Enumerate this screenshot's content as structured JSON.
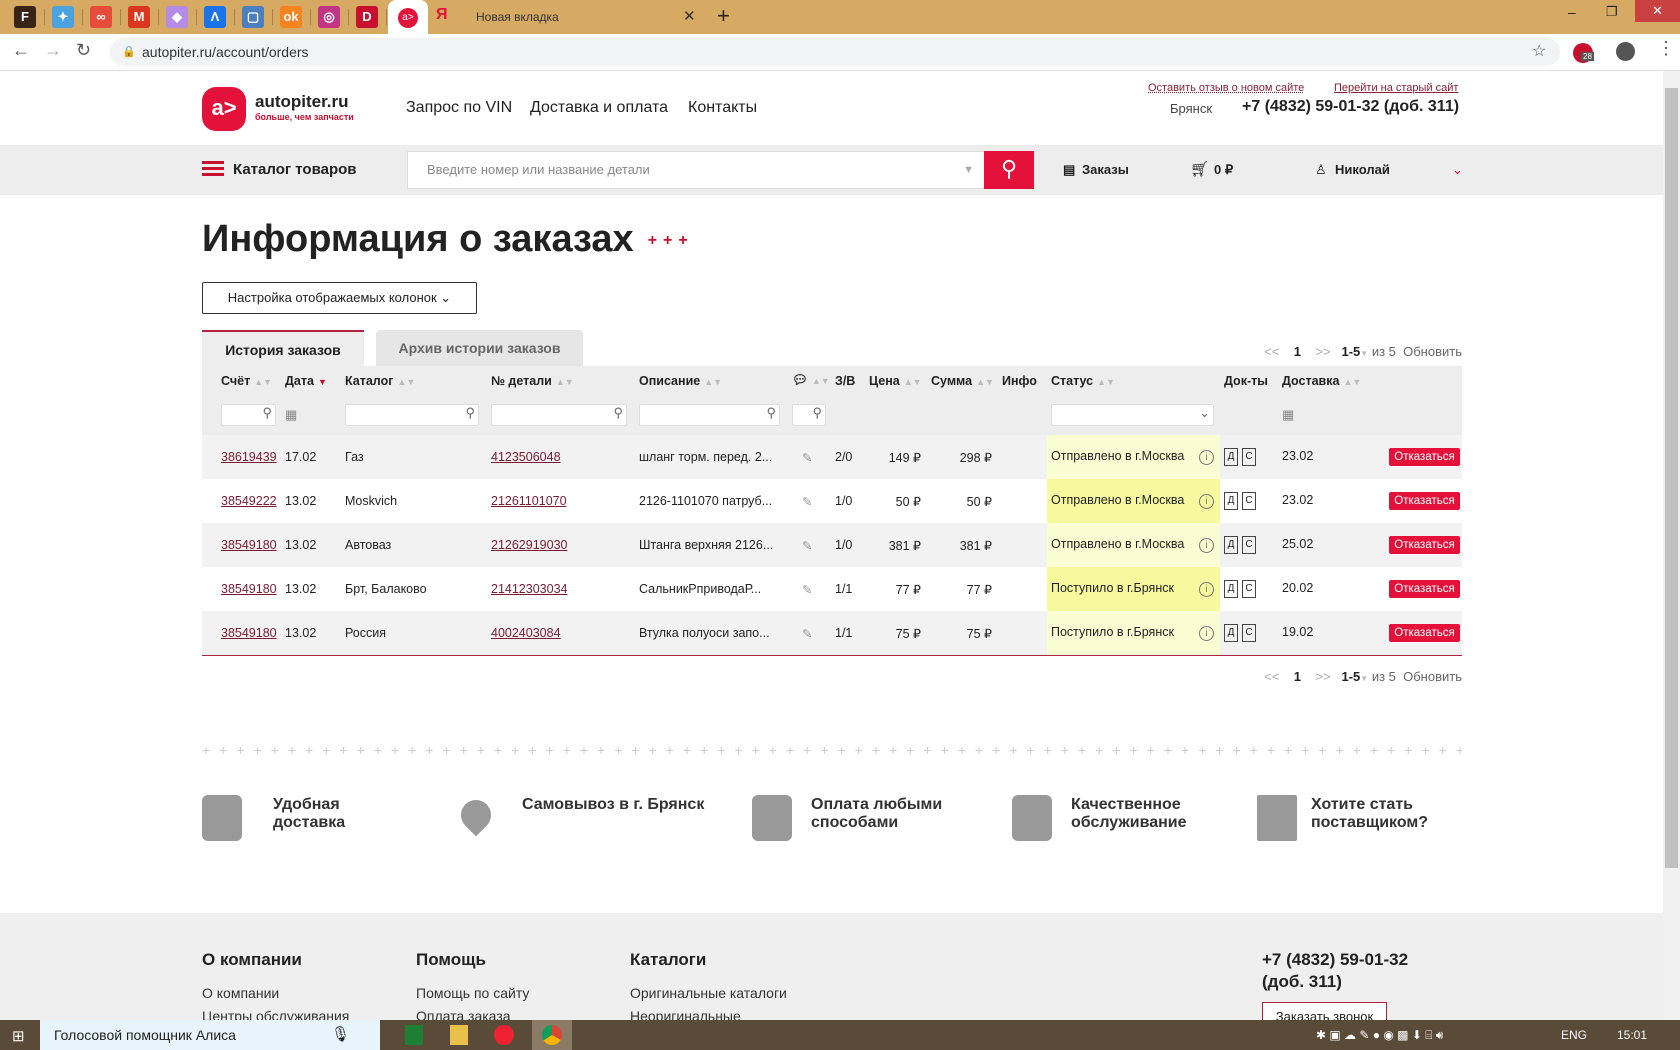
{
  "browser": {
    "new_tab_title": "Новая вкладка",
    "url": "autopiter.ru/account/orders",
    "ext_badge": "28",
    "fav_tabs": [
      {
        "g": "F",
        "c": "#3a2418"
      },
      {
        "g": "✦",
        "c": "#4aa3df"
      },
      {
        "g": "∞",
        "c": "#e64b3c"
      },
      {
        "g": "M",
        "c": "#d9381e"
      },
      {
        "g": "◆",
        "c": "#b58be8"
      },
      {
        "g": "Λ",
        "c": "#1a73e8"
      },
      {
        "g": "▢",
        "c": "#4a7fc1"
      },
      {
        "g": "ok",
        "c": "#f48420"
      },
      {
        "g": "◎",
        "c": "#c13584"
      },
      {
        "g": "D",
        "c": "#c8102e"
      }
    ]
  },
  "header": {
    "logo_text": "autopiter.ru",
    "logo_slogan": "больше, чем запчасти",
    "nav": [
      "Запрос по VIN",
      "Доставка и оплата",
      "Контакты"
    ],
    "feedback_link": "Оставить отзыв о новом сайте",
    "old_site_link": "Перейти на старый сайт",
    "city": "Брянск",
    "phone": "+7 (4832) 59-01-32 (доб. 311)"
  },
  "navbar": {
    "catalog": "Каталог товаров",
    "search_placeholder": "Введите номер или название детали",
    "orders": "Заказы",
    "cart": "0 ₽",
    "user": "Николай"
  },
  "page": {
    "title": "Информация о заказах",
    "columns_button": "Настройка отображаемых колонок",
    "tabs": [
      "История заказов",
      "Архив истории заказов"
    ],
    "pager": {
      "prev": "<<",
      "page": "1",
      "next": ">>",
      "range": "1-5",
      "of": "из 5",
      "refresh": "Обновить"
    }
  },
  "table": {
    "headers": [
      "Счёт",
      "Дата",
      "Каталог",
      "№ детали",
      "Описание",
      "",
      "З/В",
      "Цена",
      "Сумма",
      "Инфо",
      "Статус",
      "Док-ты",
      "Доставка"
    ],
    "refuse_label": "Отказаться",
    "doc_labels": [
      "Д",
      "С"
    ],
    "rows": [
      {
        "invoice": "38619439",
        "date": "17.02",
        "catalog": "Газ",
        "part": "4123506048",
        "desc": "шланг торм. перед. 2...",
        "zv": "2/0",
        "price": "149 ₽",
        "sum": "298 ₽",
        "status": "Отправлено в г.Москва",
        "delivery": "23.02"
      },
      {
        "invoice": "38549222",
        "date": "13.02",
        "catalog": "Moskvich",
        "part": "21261101070",
        "desc": "2126-1101070 патруб...",
        "zv": "1/0",
        "price": "50 ₽",
        "sum": "50 ₽",
        "status": "Отправлено в г.Москва",
        "delivery": "23.02"
      },
      {
        "invoice": "38549180",
        "date": "13.02",
        "catalog": "Автоваз",
        "part": "21262919030",
        "desc": "Штанга верхняя 2126...",
        "zv": "1/0",
        "price": "381 ₽",
        "sum": "381 ₽",
        "status": "Отправлено в г.Москва",
        "delivery": "25.02"
      },
      {
        "invoice": "38549180",
        "date": "13.02",
        "catalog": "Брт, Балаково",
        "part": "21412303034",
        "desc": "СальникРприводаР...",
        "zv": "1/1",
        "price": "77 ₽",
        "sum": "77 ₽",
        "status": "Поступило в г.Брянск",
        "delivery": "20.02"
      },
      {
        "invoice": "38549180",
        "date": "13.02",
        "catalog": "Россия",
        "part": "4002403084",
        "desc": "Втулка полуоси запо...",
        "zv": "1/1",
        "price": "75 ₽",
        "sum": "75 ₽",
        "status": "Поступило в г.Брянск",
        "delivery": "19.02"
      }
    ]
  },
  "features": [
    "Удобная доставка",
    "Самовывоз в г. Брянск",
    "Оплата любыми способами",
    "Качественное обслуживание",
    "Хотите стать поставщиком?"
  ],
  "footer": {
    "cols": [
      {
        "title": "О компании",
        "links": [
          "О компании",
          "Центры обслуживания"
        ]
      },
      {
        "title": "Помощь",
        "links": [
          "Помощь по сайту",
          "Оплата заказа"
        ]
      },
      {
        "title": "Каталоги",
        "links": [
          "Оригинальные каталоги",
          "Неоригинальные"
        ]
      }
    ],
    "phone": "+7 (4832) 59-01-32",
    "phone_ext": "(доб. 311)",
    "call_button": "Заказать звонок"
  },
  "taskbar": {
    "voice": "Голосовой помощник Алиса",
    "lang": "ENG",
    "time": "15:01"
  }
}
